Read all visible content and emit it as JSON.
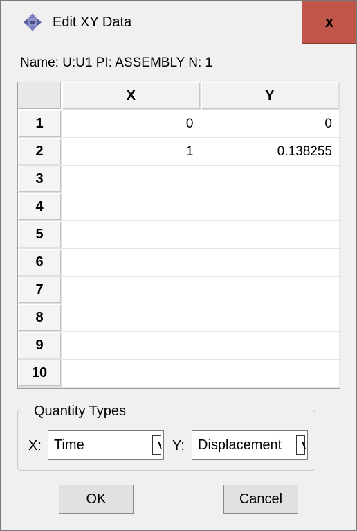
{
  "window": {
    "title": "Edit XY Data",
    "close_label": "x"
  },
  "name_line": "Name: U:U1 PI: ASSEMBLY N: 1",
  "table": {
    "headers": [
      "X",
      "Y"
    ],
    "rows": [
      {
        "num": "1",
        "x": "0",
        "y": "0"
      },
      {
        "num": "2",
        "x": "1",
        "y": "0.138255"
      },
      {
        "num": "3",
        "x": "",
        "y": ""
      },
      {
        "num": "4",
        "x": "",
        "y": ""
      },
      {
        "num": "5",
        "x": "",
        "y": ""
      },
      {
        "num": "6",
        "x": "",
        "y": ""
      },
      {
        "num": "7",
        "x": "",
        "y": ""
      },
      {
        "num": "8",
        "x": "",
        "y": ""
      },
      {
        "num": "9",
        "x": "",
        "y": ""
      },
      {
        "num": "10",
        "x": "",
        "y": ""
      }
    ]
  },
  "quantity_types": {
    "legend": "Quantity Types",
    "x_label": "X:",
    "x_value": "Time",
    "y_label": "Y:",
    "y_value": "Displacement"
  },
  "buttons": {
    "ok": "OK",
    "cancel": "Cancel"
  },
  "colors": {
    "close_bg": "#c0554a",
    "dialog_bg": "#f0f0f0",
    "icon": "#6b6fa8"
  }
}
